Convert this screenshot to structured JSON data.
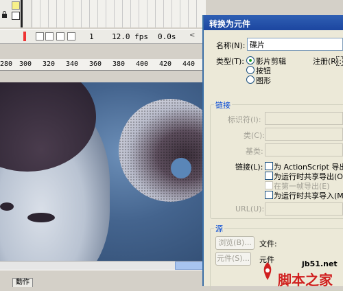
{
  "timeline": {
    "frame_number": "1",
    "fps": "12.0 fps",
    "time": "0.0s",
    "nav_arrow": "<"
  },
  "ruler": {
    "numbers": [
      "280",
      "300",
      "320",
      "340",
      "360",
      "380",
      "400",
      "420",
      "440"
    ]
  },
  "bottom": {
    "actions_tab": "動作"
  },
  "dialog": {
    "title": "转换为元件",
    "name_label": "名称(N):",
    "name_value": "碟片",
    "type_label": "类型(T):",
    "type_options": [
      "影片剪辑",
      "按钮",
      "图形"
    ],
    "type_selected": "影片剪辑",
    "registration_label": "注册(R):",
    "linkage_section": "链接",
    "identifier_label": "标识符(I):",
    "class_label": "类(C):",
    "base_class_label": "基类:",
    "linkage_label": "链接(L):",
    "linkage_options": [
      {
        "label": "为 ActionScript 导出(X)",
        "enabled": true
      },
      {
        "label": "为运行时共享导出(O)",
        "enabled": true
      },
      {
        "label": "在第一帧导出(E)",
        "enabled": false
      },
      {
        "label": "为运行时共享导入(M)",
        "enabled": true
      }
    ],
    "url_label": "URL(U):",
    "source_section": "源",
    "browse_button": "浏览(B)...",
    "file_label": "文件:",
    "symbol_button": "元件(S)...",
    "symbol_label": "元件"
  },
  "watermark": {
    "url": "jb51.net",
    "brand": "脚本之家"
  }
}
